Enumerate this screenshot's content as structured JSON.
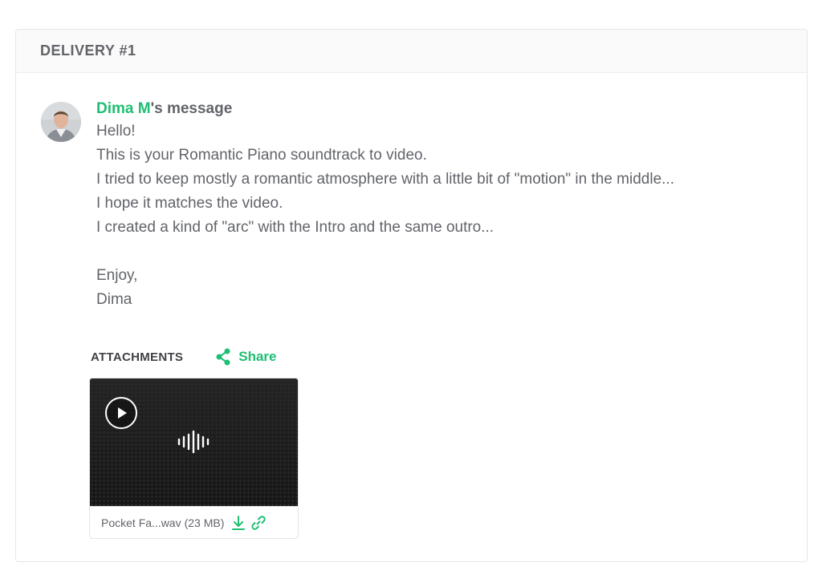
{
  "delivery": {
    "title": "DELIVERY #1"
  },
  "message": {
    "author": "Dima M",
    "header_suffix": "'s message",
    "lines": [
      "Hello!",
      "This is your Romantic Piano soundtrack to video.",
      "I tried to keep mostly a romantic atmosphere with a little bit of \"motion\" in the middle...",
      "I hope it matches the video.",
      "I created a kind of \"arc\" with the Intro and the same outro...",
      "",
      "Enjoy,",
      "Dima"
    ]
  },
  "attachments": {
    "title": "ATTACHMENTS",
    "share_label": "Share",
    "files": [
      {
        "name": "Pocket Fa...wav",
        "size": "(23 MB)"
      }
    ]
  },
  "icons": {
    "share": "share-icon",
    "play": "play-icon",
    "waveform": "audio-waveform-icon",
    "download": "download-icon",
    "link": "link-icon"
  },
  "colors": {
    "accent": "#1dbf73",
    "text": "#62646a",
    "heading": "#404145"
  }
}
